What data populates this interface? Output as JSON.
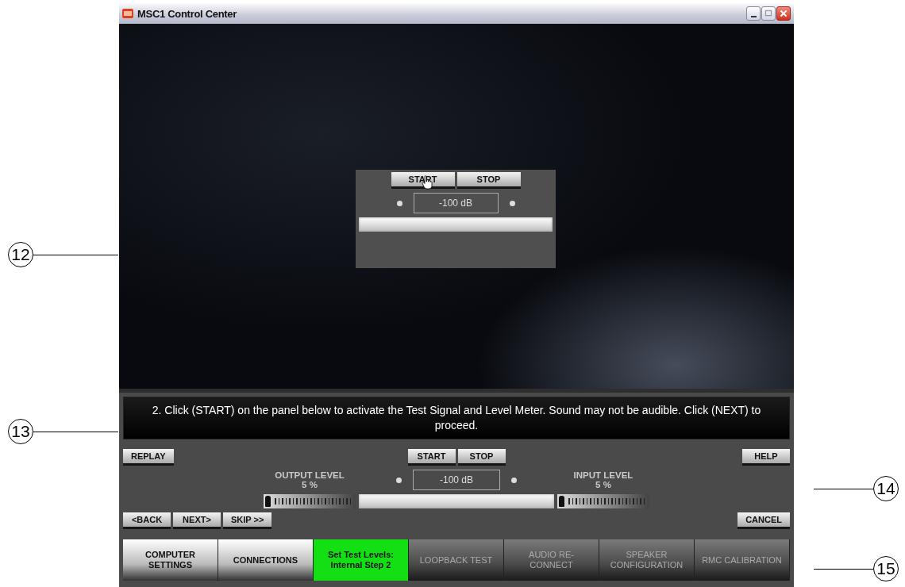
{
  "callouts": [
    "12",
    "13",
    "14",
    "15"
  ],
  "window": {
    "title": "MSC1 Control Center"
  },
  "test_panel": {
    "buttons": [
      "START",
      "STOP"
    ],
    "reading": "-100 dB"
  },
  "message": "2. Click (START) on the panel below to activate the Test Signal and Level Meter. Sound may not be audible. Click (NEXT) to proceed.",
  "controls": {
    "replay": "REPLAY",
    "help": "HELP",
    "start": "START",
    "stop": "STOP",
    "reading": "-100 dB",
    "output": {
      "label": "OUTPUT LEVEL",
      "value": "5 %",
      "level": 0.05
    },
    "input": {
      "label": "INPUT LEVEL",
      "value": "5 %",
      "level": 0.05
    },
    "nav": [
      "<BACK",
      "NEXT>",
      "SKIP >>"
    ],
    "cancel": "CANCEL"
  },
  "steps": [
    {
      "label": "COMPUTER SETTINGS",
      "selected": false,
      "disabled": false
    },
    {
      "label": "CONNECTIONS",
      "selected": false,
      "disabled": false
    },
    {
      "label": "Set Test Levels: Internal Step 2",
      "selected": true,
      "disabled": false
    },
    {
      "label": "LOOPBACK TEST",
      "selected": false,
      "disabled": true
    },
    {
      "label": "AUDIO RE-CONNECT",
      "selected": false,
      "disabled": true
    },
    {
      "label": "SPEAKER CONFIGURATION",
      "selected": false,
      "disabled": true
    },
    {
      "label": "RMC CALIBRATION",
      "selected": false,
      "disabled": true
    }
  ]
}
